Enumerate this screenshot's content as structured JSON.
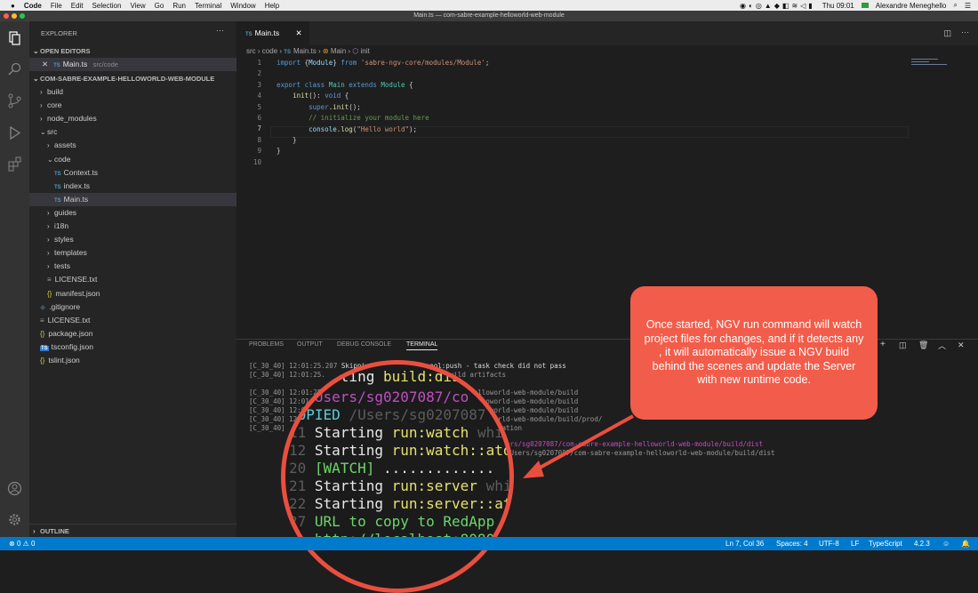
{
  "menubar": {
    "apple": "",
    "items": [
      "Code",
      "File",
      "Edit",
      "Selection",
      "View",
      "Go",
      "Run",
      "Terminal",
      "Window",
      "Help"
    ],
    "clock": "Thu 09:01",
    "user": "Alexandre Meneghello"
  },
  "window": {
    "title": "Main.ts — com-sabre-example-helloworld-web-module"
  },
  "sidebar": {
    "header": "EXPLORER",
    "open_editors": "OPEN EDITORS",
    "open_file": {
      "icon": "TS",
      "name": "Main.ts",
      "path": "src/code"
    },
    "project": "COM-SABRE-EXAMPLE-HELLOWORLD-WEB-MODULE",
    "tree": [
      {
        "name": "build",
        "type": "folder"
      },
      {
        "name": "core",
        "type": "folder"
      },
      {
        "name": "node_modules",
        "type": "folder"
      },
      {
        "name": "src",
        "type": "folder-open"
      },
      {
        "name": "assets",
        "type": "folder"
      },
      {
        "name": "code",
        "type": "folder-open"
      },
      {
        "name": "Context.ts",
        "type": "ts"
      },
      {
        "name": "index.ts",
        "type": "ts"
      },
      {
        "name": "Main.ts",
        "type": "ts"
      },
      {
        "name": "guides",
        "type": "folder"
      },
      {
        "name": "i18n",
        "type": "folder"
      },
      {
        "name": "styles",
        "type": "folder"
      },
      {
        "name": "templates",
        "type": "folder"
      },
      {
        "name": "tests",
        "type": "folder"
      },
      {
        "name": "LICENSE.txt",
        "type": "txt"
      },
      {
        "name": "manifest.json",
        "type": "json"
      },
      {
        "name": ".gitignore",
        "type": "git"
      },
      {
        "name": "LICENSE.txt",
        "type": "txt"
      },
      {
        "name": "package.json",
        "type": "json"
      },
      {
        "name": "tsconfig.json",
        "type": "tsconfig"
      },
      {
        "name": "tslint.json",
        "type": "json"
      }
    ],
    "outline": "OUTLINE"
  },
  "editor": {
    "tab": {
      "icon": "TS",
      "label": "Main.ts"
    },
    "breadcrumb": [
      "src",
      "code",
      "Main.ts",
      "Main",
      "init"
    ],
    "line_numbers": [
      "1",
      "2",
      "3",
      "4",
      "5",
      "6",
      "7",
      "8",
      "9",
      "10"
    ]
  },
  "panel": {
    "tabs": [
      "PROBLEMS",
      "OUTPUT",
      "DEBUG CONSOLE",
      "TERMINAL"
    ],
    "active_tab": "TERMINAL"
  },
  "callout": {
    "text": "Once started, NGV run command will watch project files for changes, and if it detects any , it will automatically issue a NGV build behind the scenes and update the Server with new runtime code."
  },
  "statusbar": {
    "errors": "0",
    "warnings": "0",
    "position": "Ln 7, Col 36",
    "spaces": "Spaces: 4",
    "encoding": "UTF-8",
    "eol": "LF",
    "language": "TypeScript",
    "version": "4.2.3"
  },
  "colors": {
    "statusbar": "#007acc",
    "callout": "#f25c4a",
    "accent": "#e94f3f"
  }
}
